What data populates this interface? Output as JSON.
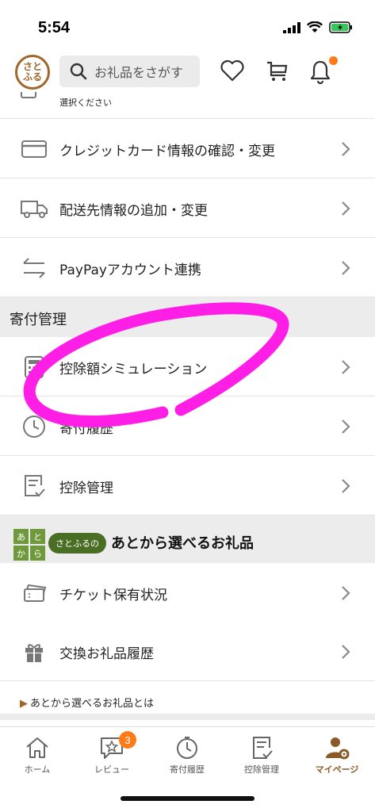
{
  "status_bar": {
    "time": "5:54"
  },
  "header": {
    "logo_text": "さとふる",
    "search_placeholder": "お礼品をさがす"
  },
  "partial_row": {
    "label": "選択ください"
  },
  "account_rows": [
    {
      "label": "クレジットカード情報の確認・変更",
      "icon": "credit-card-icon"
    },
    {
      "label": "配送先情報の追加・変更",
      "icon": "truck-icon"
    },
    {
      "label": "PayPayアカウント連携",
      "icon": "transfer-icon"
    }
  ],
  "donation_section": {
    "title": "寄付管理",
    "rows": [
      {
        "label": "控除額シミュレーション",
        "icon": "calculator-icon"
      },
      {
        "label": "寄付履歴",
        "icon": "clock-icon"
      },
      {
        "label": "控除管理",
        "icon": "checklist-icon"
      }
    ]
  },
  "banner": {
    "badge": [
      "あ",
      "と",
      "か",
      "ら"
    ],
    "pill": "さとふるの",
    "title": "あとから選べるお礼品"
  },
  "later_rows": [
    {
      "label": "チケット保有状況",
      "icon": "ticket-icon"
    },
    {
      "label": "交換お礼品履歴",
      "icon": "gift-icon"
    }
  ],
  "link": {
    "label": "あとから選べるお礼品とは"
  },
  "tab_bar": {
    "tabs": [
      {
        "label": "ホーム",
        "icon": "home-icon"
      },
      {
        "label": "レビュー",
        "icon": "review-icon",
        "badge": "3"
      },
      {
        "label": "寄付履歴",
        "icon": "clock-icon"
      },
      {
        "label": "控除管理",
        "icon": "checklist-icon"
      },
      {
        "label": "マイページ",
        "icon": "mypage-icon",
        "active": true
      }
    ]
  },
  "colors": {
    "accent": "#8a5a28",
    "notification": "#ff7a18",
    "annotation": "#ff1ee6",
    "section_bg": "#ececec"
  }
}
